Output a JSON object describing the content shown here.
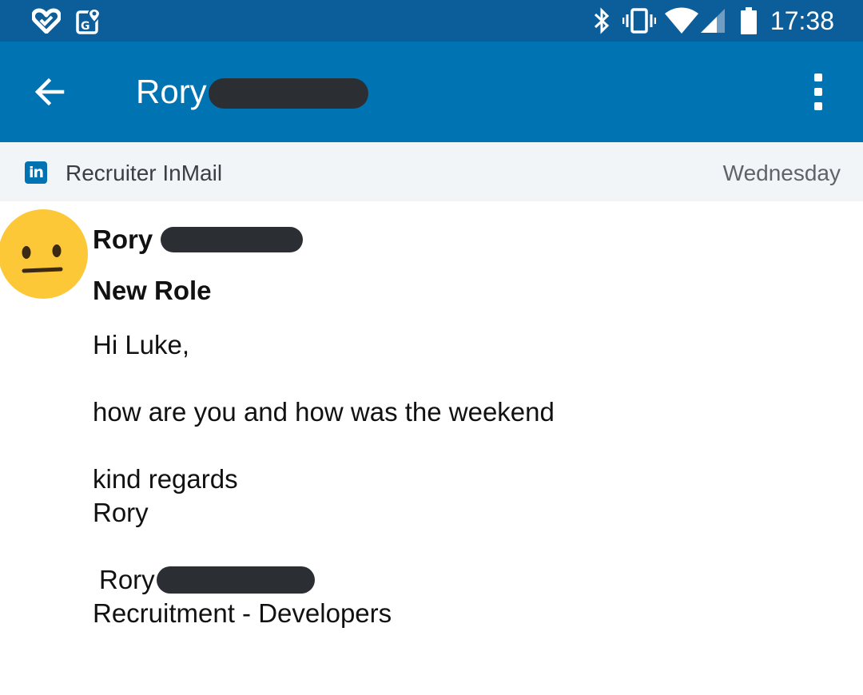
{
  "status_bar": {
    "time": "17:38",
    "icons": [
      "heart-app-icon",
      "maps-notification-icon",
      "bluetooth-icon",
      "vibrate-icon",
      "wifi-icon",
      "cell-signal-icon",
      "battery-icon"
    ]
  },
  "app_bar": {
    "back_icon": "arrow-left-icon",
    "title": "Rory",
    "menu_icon": "more-vertical-icon"
  },
  "meta": {
    "logo_text": "in",
    "type_label": "Recruiter InMail",
    "date": "Wednesday"
  },
  "message": {
    "sender": "Rory",
    "subject": "New Role",
    "greeting": "Hi Luke,",
    "body": "how are you and how was the weekend",
    "closing": "kind regards",
    "closing_name": "Rory",
    "signature_name": "Rory",
    "signature_title": "Recruitment - Developers"
  },
  "colors": {
    "status_bar": "#0b5e9a",
    "app_bar": "#0073b2",
    "meta_strip": "#f2f5f8",
    "avatar": "#fcc838",
    "redaction": "#2b2f33"
  }
}
